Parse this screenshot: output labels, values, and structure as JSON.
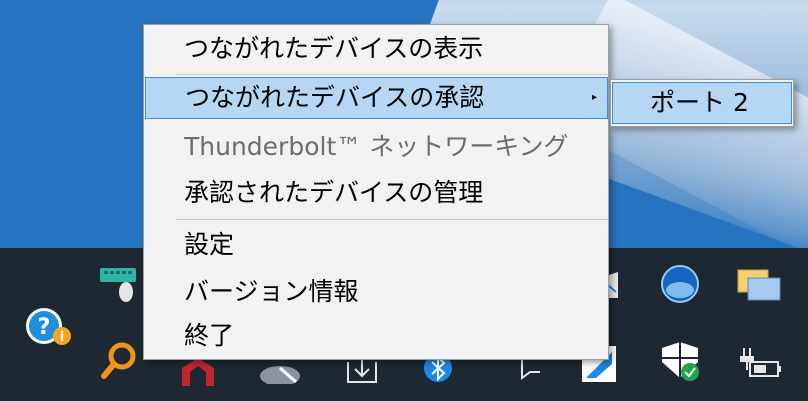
{
  "context_menu": {
    "items": [
      {
        "label": "つながれたデバイスの表示",
        "state": "normal"
      },
      {
        "label": "つながれたデバイスの承認",
        "state": "highlighted",
        "has_submenu": true
      },
      {
        "label": "Thunderbolt™ ネットワーキング",
        "state": "disabled"
      },
      {
        "label": "承認されたデバイスの管理",
        "state": "normal"
      },
      {
        "label": "設定",
        "state": "normal"
      },
      {
        "label": "バージョン情報",
        "state": "normal"
      },
      {
        "label": "終了",
        "state": "normal"
      }
    ],
    "submenu_arrow": "▸"
  },
  "submenu": {
    "items": [
      {
        "label": "ポート 2",
        "state": "highlighted"
      }
    ]
  },
  "tray_icons": [
    "keyboard-mouse-icon",
    "help-info-icon",
    "search-magnifier-icon",
    "antivirus-shield-icon",
    "cloud-icon",
    "download-icon",
    "bluetooth-icon",
    "notification-icon",
    "edge-browser-icon",
    "mail-icon",
    "network-globe-icon",
    "display-icon",
    "windows-security-icon",
    "power-battery-icon"
  ],
  "colors": {
    "menu_background": "#f2f2f2",
    "highlight_fill": "#b5d7f3",
    "highlight_border": "#3c8cdc",
    "disabled_text": "#6d6d6d",
    "taskbar": "#1e2833"
  }
}
